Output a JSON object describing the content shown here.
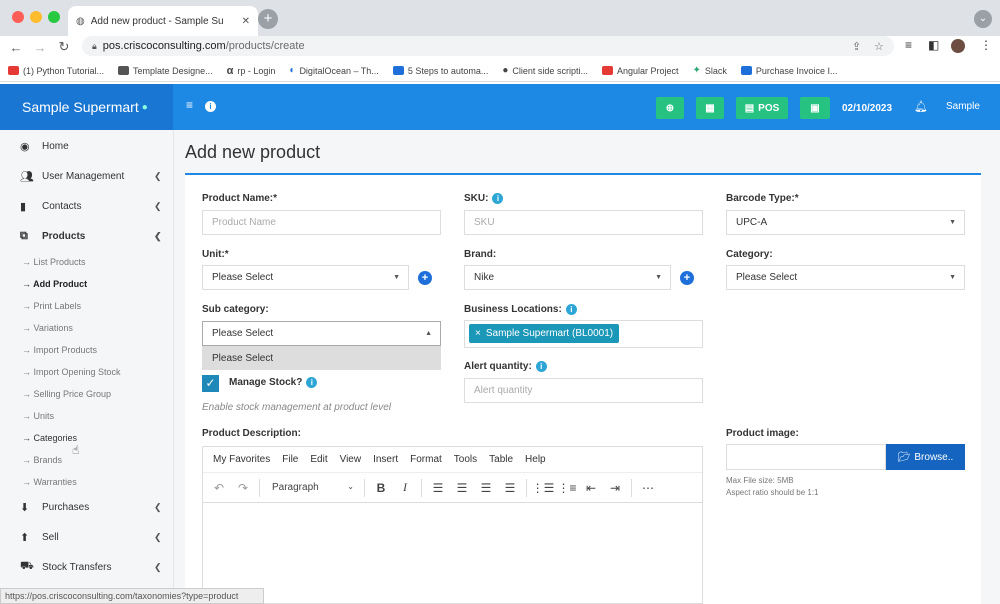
{
  "browser": {
    "tab_title": "Add new product - Sample Su",
    "url_host": "pos.criscoconsulting.com",
    "url_path": "/products/create",
    "bookmarks": [
      {
        "label": "(1) Python Tutorial...",
        "color": "#e53935"
      },
      {
        "label": "Template Designe...",
        "color": "#555555"
      },
      {
        "label": "rp - Login",
        "color": "#222222"
      },
      {
        "label": "DigitalOcean – Th...",
        "color": "#1e6fd9"
      },
      {
        "label": "5 Steps to automa...",
        "color": "#1e6fd9"
      },
      {
        "label": "Client side scripti...",
        "color": "#222222"
      },
      {
        "label": "Angular Project",
        "color": "#e53935"
      },
      {
        "label": "Slack",
        "color": "#2aa876"
      },
      {
        "label": "Purchase Invoice I...",
        "color": "#1e6fd9"
      }
    ],
    "status_url": "https://pos.criscoconsulting.com/taxonomies?type=product"
  },
  "header": {
    "brand": "Sample Supermart",
    "pos_label": "POS",
    "date": "02/10/2023",
    "user": "Sample"
  },
  "sidebar": {
    "items": [
      {
        "label": "Home",
        "icon": "palette-icon"
      },
      {
        "label": "User Management",
        "icon": "users-icon"
      },
      {
        "label": "Contacts",
        "icon": "address-book-icon"
      },
      {
        "label": "Products",
        "icon": "cubes-icon"
      }
    ],
    "products_sub": [
      "List Products",
      "Add Product",
      "Print Labels",
      "Variations",
      "Import Products",
      "Import Opening Stock",
      "Selling Price Group",
      "Units",
      "Categories",
      "Brands",
      "Warranties"
    ],
    "bottom_items": [
      {
        "label": "Purchases",
        "icon": "arrow-circle-down-icon"
      },
      {
        "label": "Sell",
        "icon": "arrow-circle-up-icon"
      },
      {
        "label": "Stock Transfers",
        "icon": "truck-icon"
      }
    ]
  },
  "page": {
    "title": "Add new product"
  },
  "form": {
    "product_name_label": "Product Name:*",
    "product_name_placeholder": "Product Name",
    "sku_label": "SKU:",
    "sku_placeholder": "SKU",
    "barcode_label": "Barcode Type:*",
    "barcode_value": "UPC-A",
    "unit_label": "Unit:*",
    "unit_value": "Please Select",
    "brand_label": "Brand:",
    "brand_value": "Nike",
    "category_label": "Category:",
    "category_value": "Please Select",
    "subcategory_label": "Sub category:",
    "subcategory_value": "Please Select",
    "subcategory_option": "Please Select",
    "locations_label": "Business Locations:",
    "location_tag": "Sample Supermart (BL0001)",
    "manage_stock_label": "Manage Stock?",
    "manage_stock_hint": "Enable stock management at product level",
    "alert_qty_label": "Alert quantity:",
    "alert_qty_placeholder": "Alert quantity",
    "description_label": "Product Description:",
    "image_label": "Product image:",
    "browse_label": "Browse..",
    "max_size": "Max File size: 5MB",
    "aspect": "Aspect ratio should be 1:1"
  },
  "editor": {
    "menu": [
      "My Favorites",
      "File",
      "Edit",
      "View",
      "Insert",
      "Format",
      "Tools",
      "Table",
      "Help"
    ],
    "paragraph": "Paragraph"
  }
}
